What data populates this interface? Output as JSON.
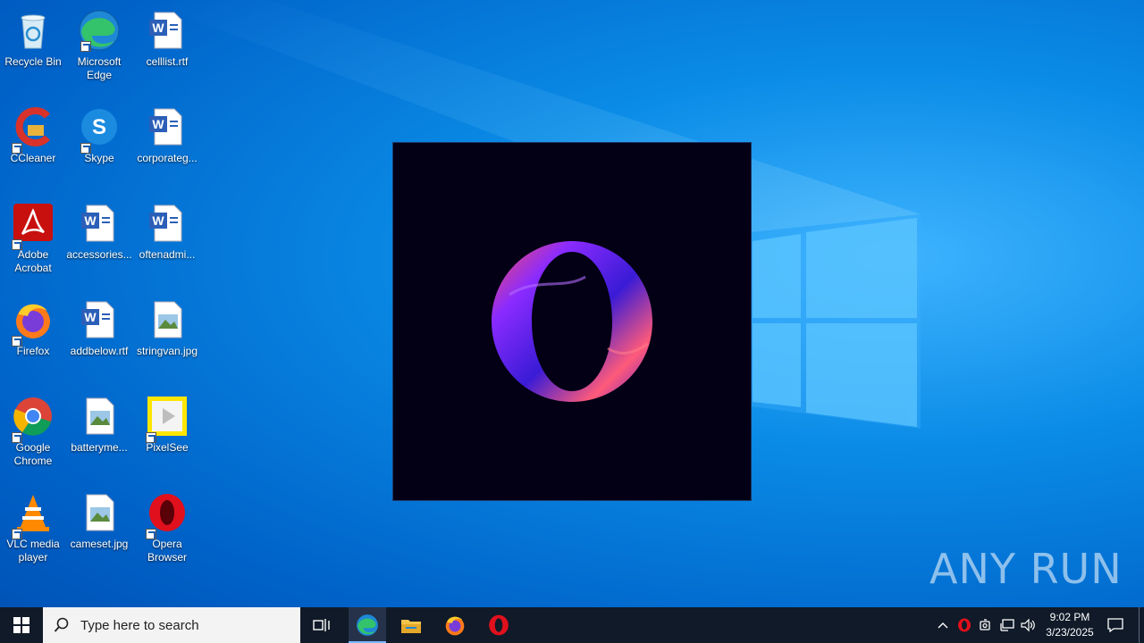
{
  "desktop": {
    "icons": [
      {
        "label": "Recycle Bin"
      },
      {
        "label": "Microsoft Edge"
      },
      {
        "label": "celllist.rtf"
      },
      {
        "label": "CCleaner"
      },
      {
        "label": "Skype"
      },
      {
        "label": "corporateg..."
      },
      {
        "label": "Adobe Acrobat"
      },
      {
        "label": "accessories..."
      },
      {
        "label": "oftenadmi..."
      },
      {
        "label": "Firefox"
      },
      {
        "label": "addbelow.rtf"
      },
      {
        "label": "stringvan.jpg"
      },
      {
        "label": "Google Chrome"
      },
      {
        "label": "batteryme..."
      },
      {
        "label": "PixelSee"
      },
      {
        "label": "VLC media player"
      },
      {
        "label": "cameset.jpg"
      },
      {
        "label": "Opera Browser"
      }
    ]
  },
  "watermark": {
    "text": "ANY RUN"
  },
  "taskbar": {
    "search_placeholder": "Type here to search",
    "clock_time": "9:02 PM",
    "clock_date": "3/23/2025"
  },
  "colors": {
    "taskbar": "#101a28",
    "opera_red": "#e0101c",
    "desktop_blue": "#0a8be6"
  }
}
